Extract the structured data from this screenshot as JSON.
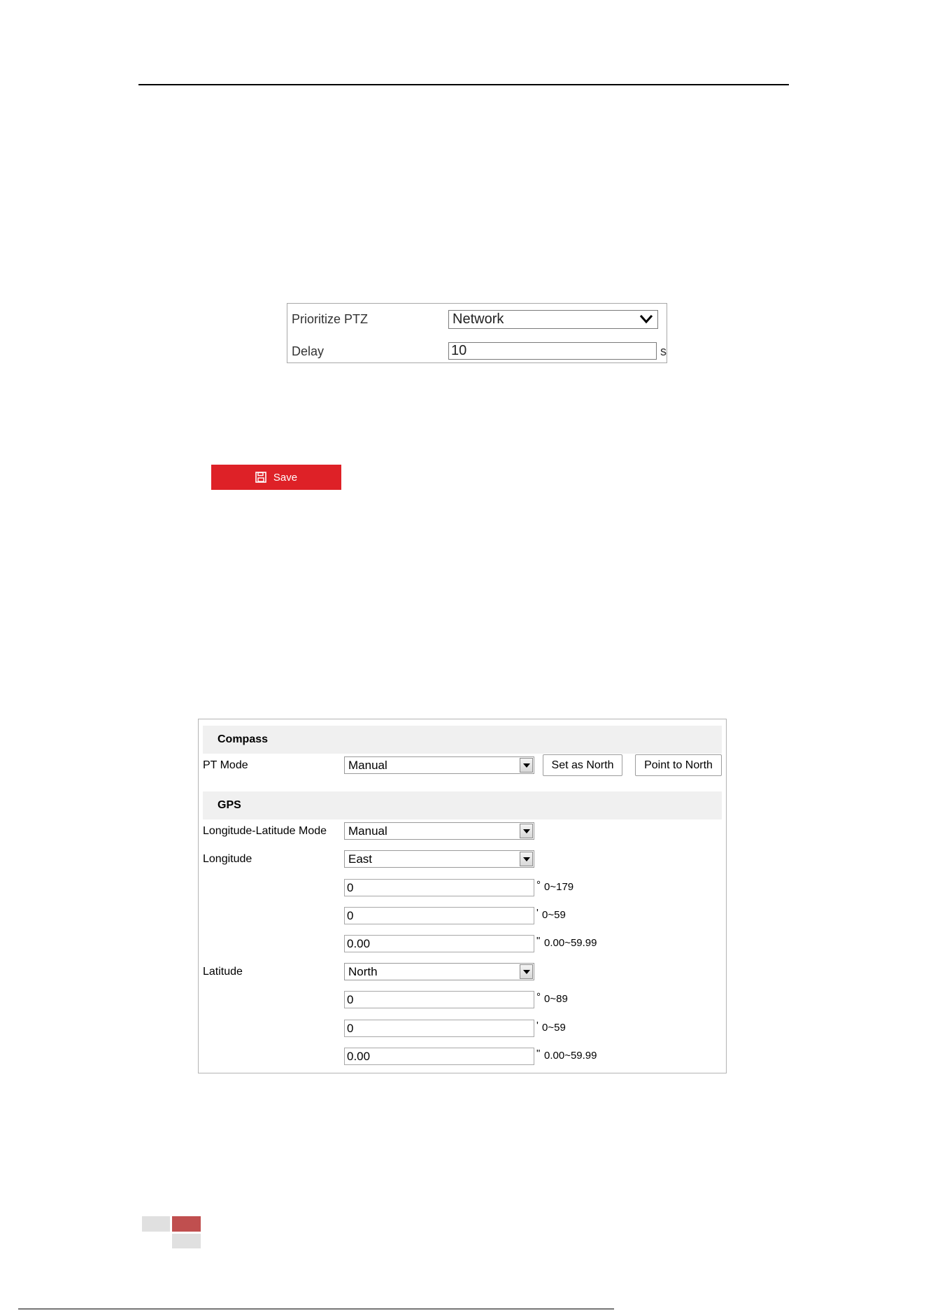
{
  "ptz": {
    "prioritize_label": "Prioritize PTZ",
    "prioritize_value": "Network",
    "delay_label": "Delay",
    "delay_value": "10",
    "delay_unit": "s"
  },
  "save_button": {
    "label": "Save"
  },
  "compass": {
    "title": "Compass",
    "pt_mode_label": "PT Mode",
    "pt_mode_value": "Manual",
    "set_as_north": "Set as North",
    "point_to_north": "Point to North"
  },
  "gps": {
    "title": "GPS",
    "mode_label": "Longitude-Latitude Mode",
    "mode_value": "Manual",
    "longitude": {
      "label": "Longitude",
      "direction": "East",
      "degrees": "0",
      "degrees_unit": "°",
      "degrees_range": "0~179",
      "minutes": "0",
      "minutes_unit": "'",
      "minutes_range": "0~59",
      "seconds": "0.00",
      "seconds_unit": "\"",
      "seconds_range": "0.00~59.99"
    },
    "latitude": {
      "label": "Latitude",
      "direction": "North",
      "degrees": "0",
      "degrees_unit": "°",
      "degrees_range": "0~89",
      "minutes": "0",
      "minutes_unit": "'",
      "minutes_range": "0~59",
      "seconds": "0.00",
      "seconds_unit": "\"",
      "seconds_range": "0.00~59.99"
    }
  },
  "colors": {
    "save_red": "#de2127",
    "footer_red": "#c04f4f",
    "footer_gray": "#e0e0e0",
    "section_bg": "#f0f0f0"
  }
}
